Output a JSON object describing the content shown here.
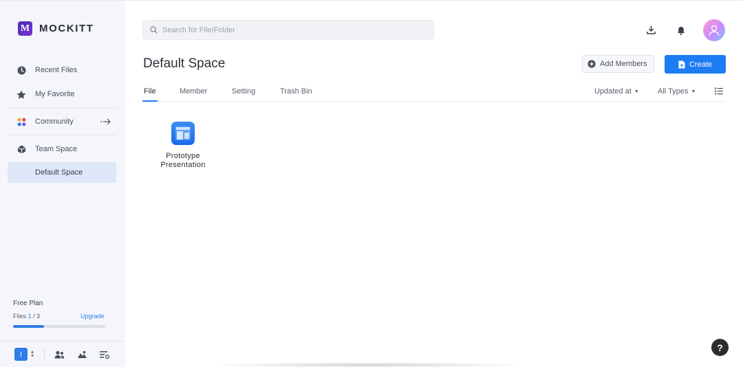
{
  "brand": {
    "name": "MOCKITT",
    "mark": "M"
  },
  "sidebar": {
    "items": [
      {
        "label": "Recent Files",
        "icon": "clock-icon"
      },
      {
        "label": "My Favorite",
        "icon": "star-icon"
      },
      {
        "label": "Community",
        "icon": "apps-icon"
      },
      {
        "label": "Team Space",
        "icon": "cube-icon"
      },
      {
        "label": "Default Space"
      }
    ],
    "plan": {
      "title": "Free Plan",
      "files_prefix": "Files ",
      "files_used": "1",
      "files_total": " / 3",
      "upgrade": "Upgrade",
      "usage_fraction": 0.33
    },
    "team_initial": "I"
  },
  "search": {
    "placeholder": "Search for File/Folder"
  },
  "main": {
    "title": "Default Space",
    "add_members": "Add Members",
    "create": "Create",
    "tabs": [
      "File",
      "Member",
      "Setting",
      "Trash Bin"
    ],
    "sort_by": "Updated at",
    "type_filter": "All Types"
  },
  "files": [
    {
      "name_line1": "Prototype",
      "name_line2": "Presentation"
    }
  ],
  "help": "?",
  "colors": {
    "accent": "#1e7cf2",
    "active_nav": "#dde7f8",
    "sidebar_bg": "#f4f6fb"
  }
}
